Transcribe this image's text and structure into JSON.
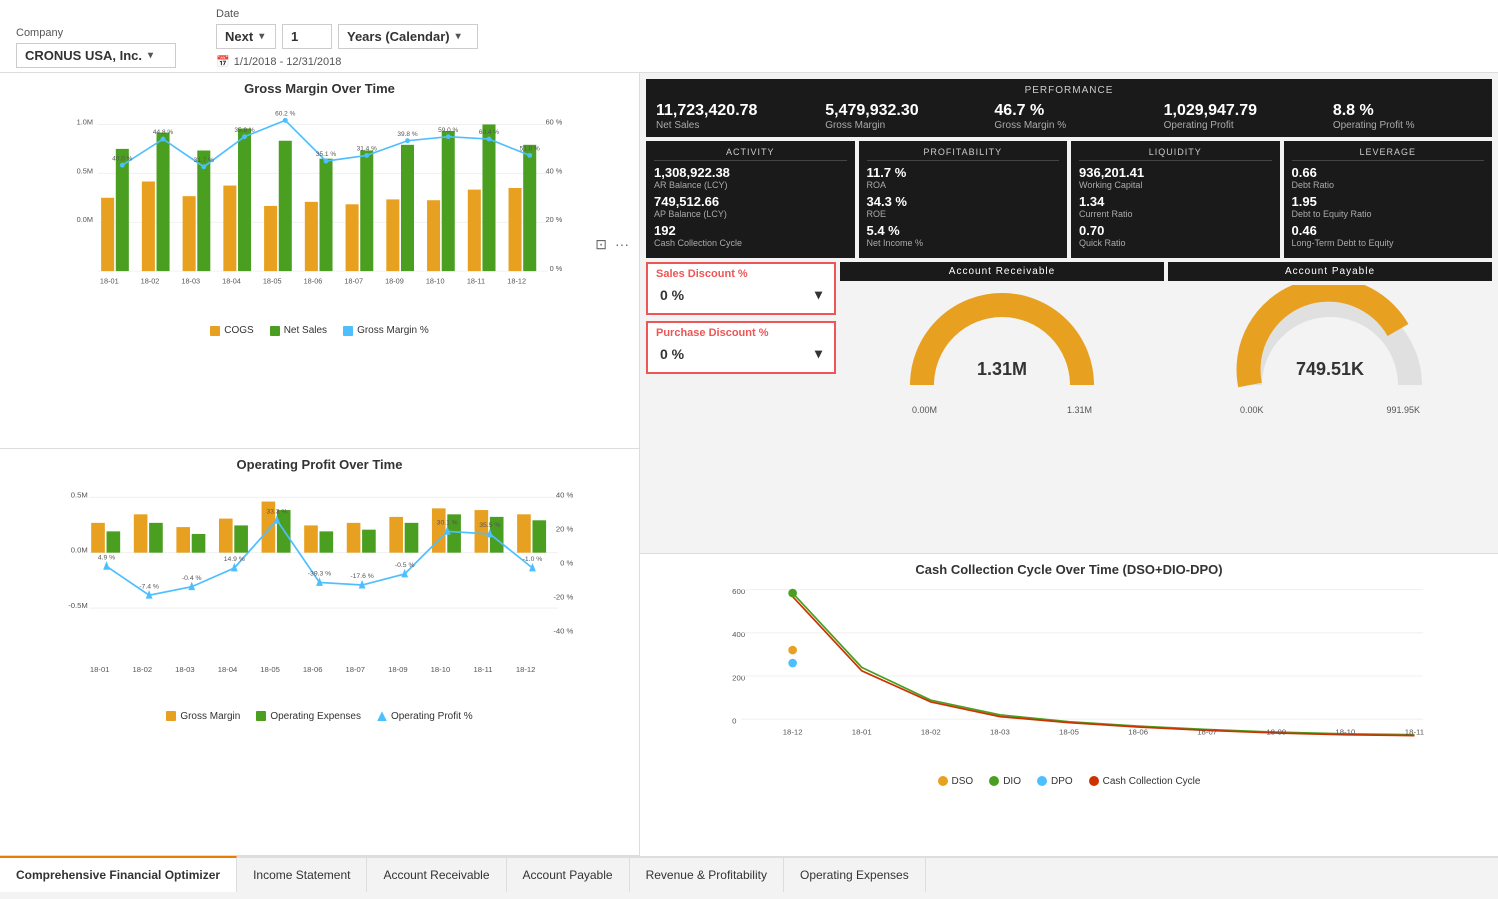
{
  "filter": {
    "company_label": "Company",
    "company_value": "CRONUS USA, Inc.",
    "date_label": "Date",
    "date_filter1": "Next",
    "date_filter2": "1",
    "date_filter3": "Years (Calendar)",
    "date_range": "1/1/2018 - 12/31/2018"
  },
  "performance": {
    "title": "PERFORMANCE",
    "metrics": [
      {
        "value": "11,723,420.78",
        "label": "Net Sales"
      },
      {
        "value": "5,479,932.30",
        "label": "Gross Margin"
      },
      {
        "value": "46.7 %",
        "label": "Gross Margin %"
      },
      {
        "value": "1,029,947.79",
        "label": "Operating Profit"
      },
      {
        "value": "8.8 %",
        "label": "Operating Profit %"
      }
    ]
  },
  "kpi": {
    "activity": {
      "title": "ACTIVITY",
      "items": [
        {
          "value": "1,308,922.38",
          "label": "AR Balance (LCY)"
        },
        {
          "value": "749,512.66",
          "label": "AP Balance (LCY)"
        },
        {
          "value": "192",
          "label": "Cash Collection Cycle"
        }
      ]
    },
    "profitability": {
      "title": "PROFITABILITY",
      "items": [
        {
          "value": "11.7 %",
          "label": "ROA"
        },
        {
          "value": "34.3 %",
          "label": "ROE"
        },
        {
          "value": "5.4 %",
          "label": "Net Income %"
        }
      ]
    },
    "liquidity": {
      "title": "LIQUIDITY",
      "items": [
        {
          "value": "936,201.41",
          "label": "Working Capital"
        },
        {
          "value": "1.34",
          "label": "Current Ratio"
        },
        {
          "value": "0.70",
          "label": "Quick Ratio"
        }
      ]
    },
    "leverage": {
      "title": "LEVERAGE",
      "items": [
        {
          "value": "0.66",
          "label": "Debt Ratio"
        },
        {
          "value": "1.95",
          "label": "Debt to Equity Ratio"
        },
        {
          "value": "0.46",
          "label": "Long-Term Debt to Equity"
        }
      ]
    }
  },
  "discounts": {
    "sales_label": "Sales Discount %",
    "sales_value": "0 %",
    "purchase_label": "Purchase Discount %",
    "purchase_value": "0 %"
  },
  "ar_gauge": {
    "title": "Account Receivable",
    "value": "1.31M",
    "min": "0.00M",
    "max": "1.31M"
  },
  "ap_gauge": {
    "title": "Account Payable",
    "value": "749.51K",
    "min": "0.00K",
    "max": "991.95K"
  },
  "gross_margin_chart": {
    "title": "Gross Margin Over Time",
    "legend": [
      "COGS",
      "Net Sales",
      "Gross Margin %"
    ]
  },
  "operating_profit_chart": {
    "title": "Operating Profit Over Time",
    "legend": [
      "Gross Margin",
      "Operating Expenses",
      "Operating Profit %"
    ]
  },
  "cash_collection_chart": {
    "title": "Cash Collection Cycle Over Time (DSO+DIO-DPO)",
    "legend": [
      "DSO",
      "DIO",
      "DPO",
      "Cash Collection Cycle"
    ]
  },
  "tabs": [
    {
      "label": "Comprehensive Financial Optimizer",
      "active": true
    },
    {
      "label": "Income Statement",
      "active": false
    },
    {
      "label": "Account Receivable",
      "active": false
    },
    {
      "label": "Account Payable",
      "active": false
    },
    {
      "label": "Revenue & Profitability",
      "active": false
    },
    {
      "label": "Operating Expenses",
      "active": false
    }
  ]
}
